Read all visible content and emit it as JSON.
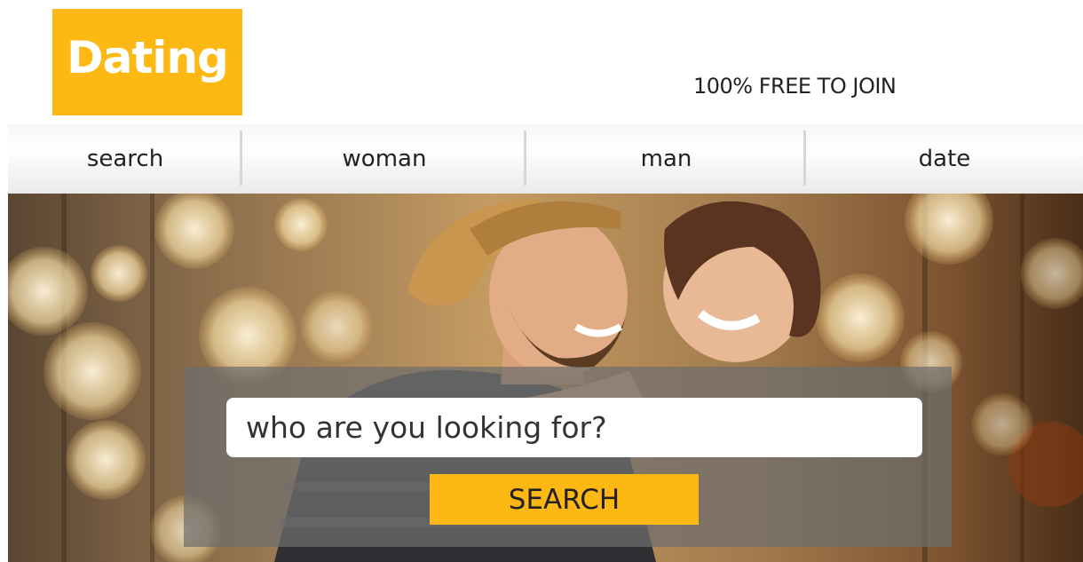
{
  "brand": {
    "logo_text": "Dating",
    "accent_color": "#fdb813"
  },
  "header": {
    "tagline": "100% FREE TO JOIN"
  },
  "nav": {
    "items": [
      "search",
      "woman",
      "man",
      "date"
    ]
  },
  "hero": {
    "image": "couple-photo",
    "search": {
      "placeholder": "who are you looking for?",
      "value": ""
    },
    "button_label": "SEARCH"
  }
}
